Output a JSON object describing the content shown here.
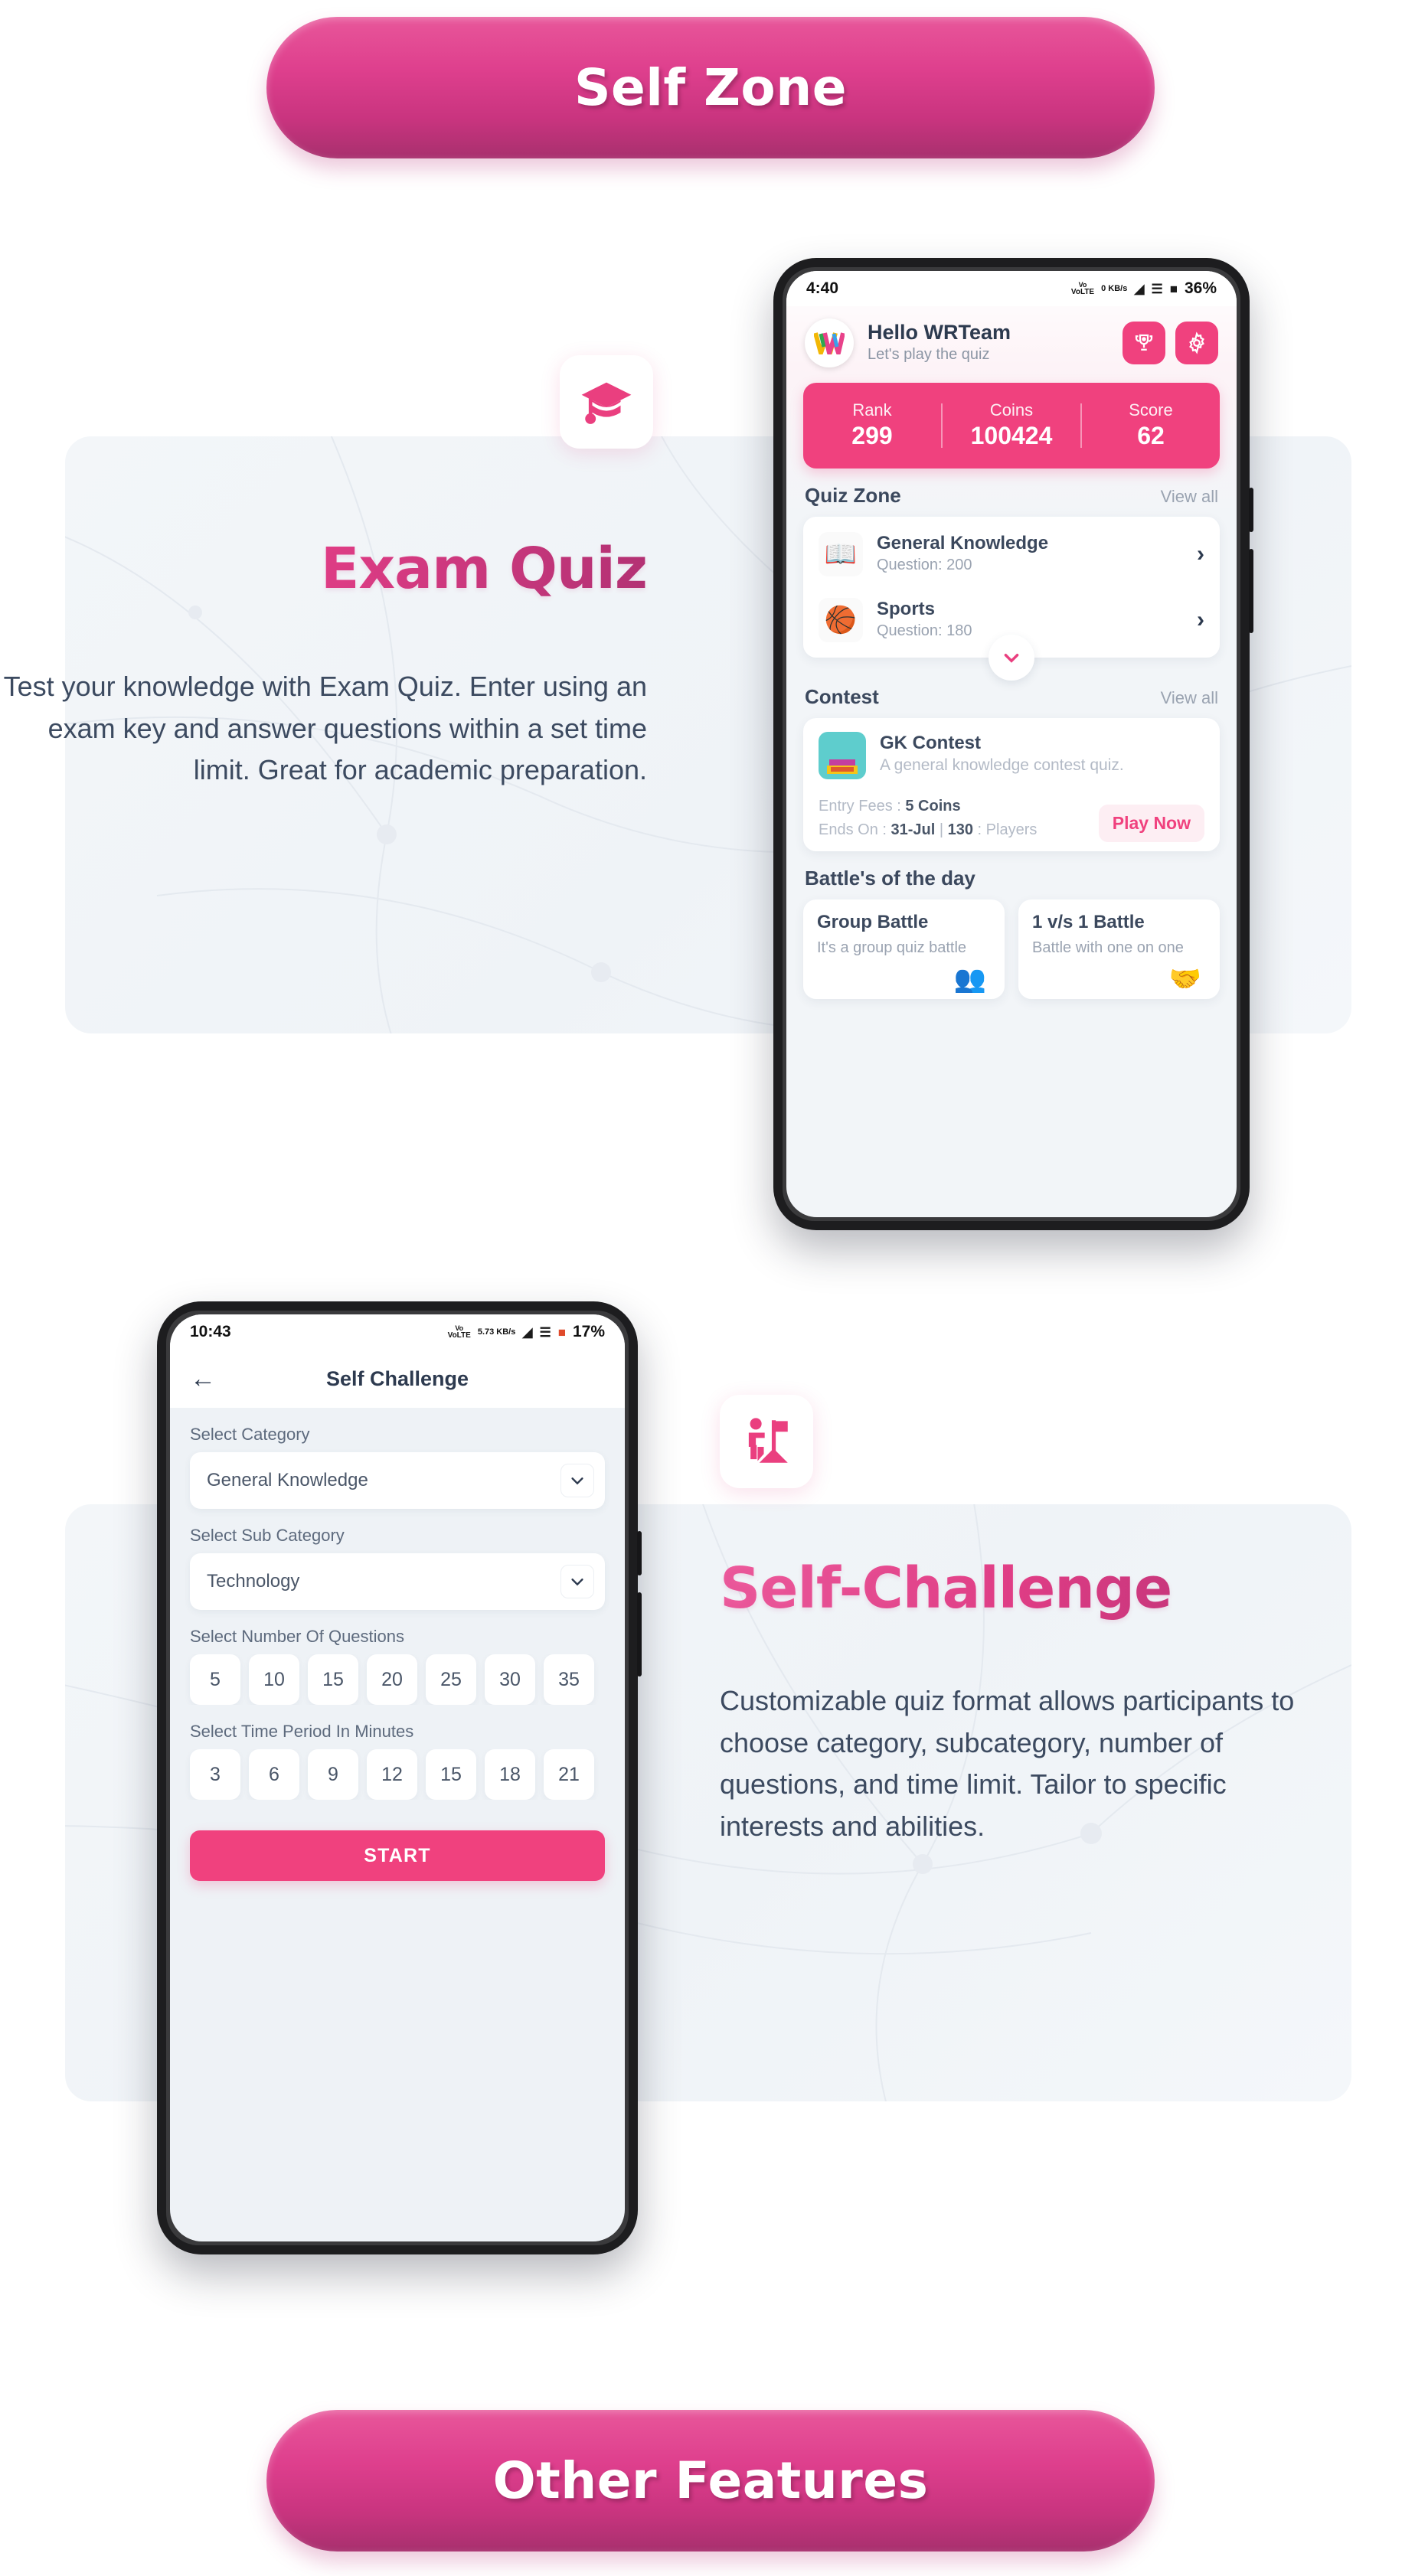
{
  "banners": {
    "top": "Self Zone",
    "bottom": "Other Features"
  },
  "features": [
    {
      "icon": "graduation-cap-icon",
      "title": "Exam Quiz",
      "body": "Test your knowledge with Exam Quiz. Enter using an exam key and answer questions within a set time limit. Great for academic preparation."
    },
    {
      "icon": "self-challenge-flag-icon",
      "title": "Self-Challenge",
      "body": "Customizable quiz format allows participants to choose category, subcategory, number of questions, and time limit. Tailor to specific interests and abilities."
    }
  ],
  "phone1": {
    "status": {
      "time": "4:40",
      "network": "VoLTE",
      "data": "0 KB/s",
      "battery": "36%"
    },
    "header": {
      "avatar_text": "W",
      "greeting": "Hello WRTeam",
      "subtitle": "Let's play the quiz",
      "trophy_icon": "trophy-icon",
      "settings_icon": "gear-icon"
    },
    "stats": [
      {
        "label": "Rank",
        "value": "299"
      },
      {
        "label": "Coins",
        "value": "100424"
      },
      {
        "label": "Score",
        "value": "62"
      }
    ],
    "quiz_zone": {
      "title": "Quiz Zone",
      "view_all": "View all",
      "items": [
        {
          "name": "General Knowledge",
          "questions": "Question: 200",
          "icon": "book-bulb-icon",
          "chevron": "›"
        },
        {
          "name": "Sports",
          "questions": "Question: 180",
          "icon": "sports-balls-icon",
          "chevron": "›"
        }
      ]
    },
    "contest": {
      "title": "Contest",
      "view_all": "View all",
      "item": {
        "name": "GK Contest",
        "description": "A general knowledge contest quiz.",
        "entry_fees_label": "Entry Fees : ",
        "entry_fees_value": "5 Coins",
        "ends_on_label": "Ends On : ",
        "ends_on_value": "31-Jul",
        "separator": " | ",
        "players_value": "130",
        "players_label": " : Players",
        "play_button": "Play Now"
      }
    },
    "battles": {
      "title": "Battle's of the day",
      "cards": [
        {
          "name": "Group Battle",
          "description": "It's a group quiz battle",
          "icon": "group-people-icon"
        },
        {
          "name": "1 v/s 1 Battle",
          "description": "Battle with one on one",
          "icon": "handshake-icon"
        }
      ]
    }
  },
  "phone2": {
    "status": {
      "time": "10:43",
      "network": "VoLTE",
      "data": "5.73 KB/s",
      "battery": "17%"
    },
    "appbar": {
      "back_icon": "back-arrow-icon",
      "title": "Self Challenge"
    },
    "category": {
      "label": "Select Category",
      "value": "General Knowledge",
      "chevron_icon": "chevron-down-icon"
    },
    "subcategory": {
      "label": "Select Sub Category",
      "value": "Technology",
      "chevron_icon": "chevron-down-icon"
    },
    "questions": {
      "label": "Select Number Of Questions",
      "options": [
        "5",
        "10",
        "15",
        "20",
        "25",
        "30",
        "35"
      ]
    },
    "time": {
      "label": "Select Time Period In Minutes",
      "options": [
        "3",
        "6",
        "9",
        "12",
        "15",
        "18",
        "21"
      ]
    },
    "start_button": "START"
  },
  "colors": {
    "brand_pink": "#f0417e",
    "banner_gradient_from": "#e8569a",
    "banner_gradient_to": "#a8306e",
    "text_dark": "#2d3a4f",
    "card_bg": "#f2f5f8"
  }
}
